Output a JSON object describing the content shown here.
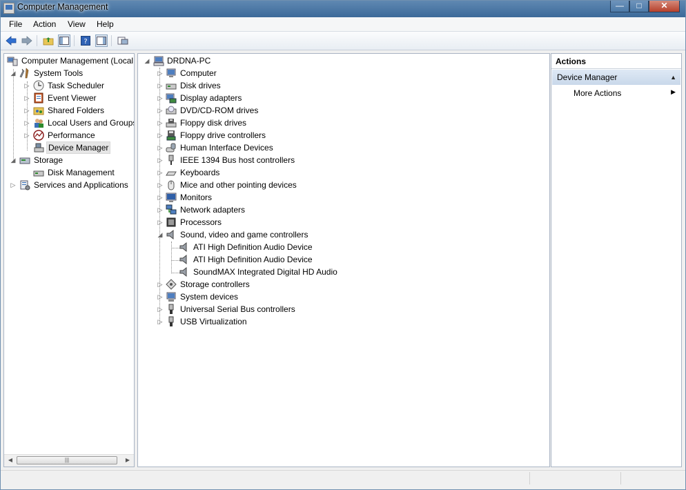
{
  "window": {
    "title": "Computer Management",
    "caption": {
      "minimize": "—",
      "maximize": "□",
      "close": "✕"
    }
  },
  "menu": [
    "File",
    "Action",
    "View",
    "Help"
  ],
  "toolbar": {
    "icons": [
      "back-arrow-icon",
      "forward-arrow-icon",
      "up-folder-icon",
      "show-hide-console-tree-icon",
      "help-icon",
      "show-hide-action-pane-icon",
      "properties-icon"
    ],
    "colors": {
      "back": "#2f6fd1",
      "forward": "#7a8fa6"
    }
  },
  "left_tree": {
    "items": [
      {
        "label": "Computer Management (Local",
        "icon": "computer-management-icon"
      },
      {
        "label": "System Tools",
        "icon": "system-tools-icon"
      },
      {
        "label": "Task Scheduler",
        "icon": "task-scheduler-icon"
      },
      {
        "label": "Event Viewer",
        "icon": "event-viewer-icon"
      },
      {
        "label": "Shared Folders",
        "icon": "shared-folders-icon"
      },
      {
        "label": "Local Users and Groups",
        "icon": "local-users-groups-icon"
      },
      {
        "label": "Performance",
        "icon": "performance-icon"
      },
      {
        "label": "Device Manager",
        "icon": "device-manager-icon",
        "selected": true
      },
      {
        "label": "Storage",
        "icon": "storage-icon"
      },
      {
        "label": "Disk Management",
        "icon": "disk-management-icon"
      },
      {
        "label": "Services and Applications",
        "icon": "services-applications-icon"
      }
    ],
    "scroll_grip": "|||"
  },
  "device_tree": {
    "root": {
      "label": "DRDNA-PC",
      "icon": "computer-icon"
    },
    "categories": [
      {
        "label": "Computer",
        "icon": "computer-icon"
      },
      {
        "label": "Disk drives",
        "icon": "disk-drive-icon"
      },
      {
        "label": "Display adapters",
        "icon": "display-adapter-icon"
      },
      {
        "label": "DVD/CD-ROM drives",
        "icon": "dvd-drive-icon"
      },
      {
        "label": "Floppy disk drives",
        "icon": "floppy-drive-icon"
      },
      {
        "label": "Floppy drive controllers",
        "icon": "floppy-controller-icon"
      },
      {
        "label": "Human Interface Devices",
        "icon": "hid-icon"
      },
      {
        "label": "IEEE 1394 Bus host controllers",
        "icon": "ieee1394-icon"
      },
      {
        "label": "Keyboards",
        "icon": "keyboard-icon"
      },
      {
        "label": "Mice and other pointing devices",
        "icon": "mouse-icon"
      },
      {
        "label": "Monitors",
        "icon": "monitor-icon"
      },
      {
        "label": "Network adapters",
        "icon": "network-adapter-icon"
      },
      {
        "label": "Processors",
        "icon": "processor-icon"
      },
      {
        "label": "Sound, video and game controllers",
        "icon": "speaker-icon",
        "expanded": true,
        "children": [
          {
            "label": "ATI High Definition Audio Device",
            "icon": "speaker-icon"
          },
          {
            "label": "ATI High Definition Audio Device",
            "icon": "speaker-icon"
          },
          {
            "label": "SoundMAX Integrated Digital HD Audio",
            "icon": "speaker-icon"
          }
        ]
      },
      {
        "label": "Storage controllers",
        "icon": "storage-controller-icon"
      },
      {
        "label": "System devices",
        "icon": "system-devices-icon"
      },
      {
        "label": "Universal Serial Bus controllers",
        "icon": "usb-icon"
      },
      {
        "label": "USB Virtualization",
        "icon": "usb-icon"
      }
    ]
  },
  "actions": {
    "header": "Actions",
    "group": "Device Manager",
    "more": "More Actions",
    "collapse_glyph": "▲",
    "more_glyph": "▶"
  }
}
